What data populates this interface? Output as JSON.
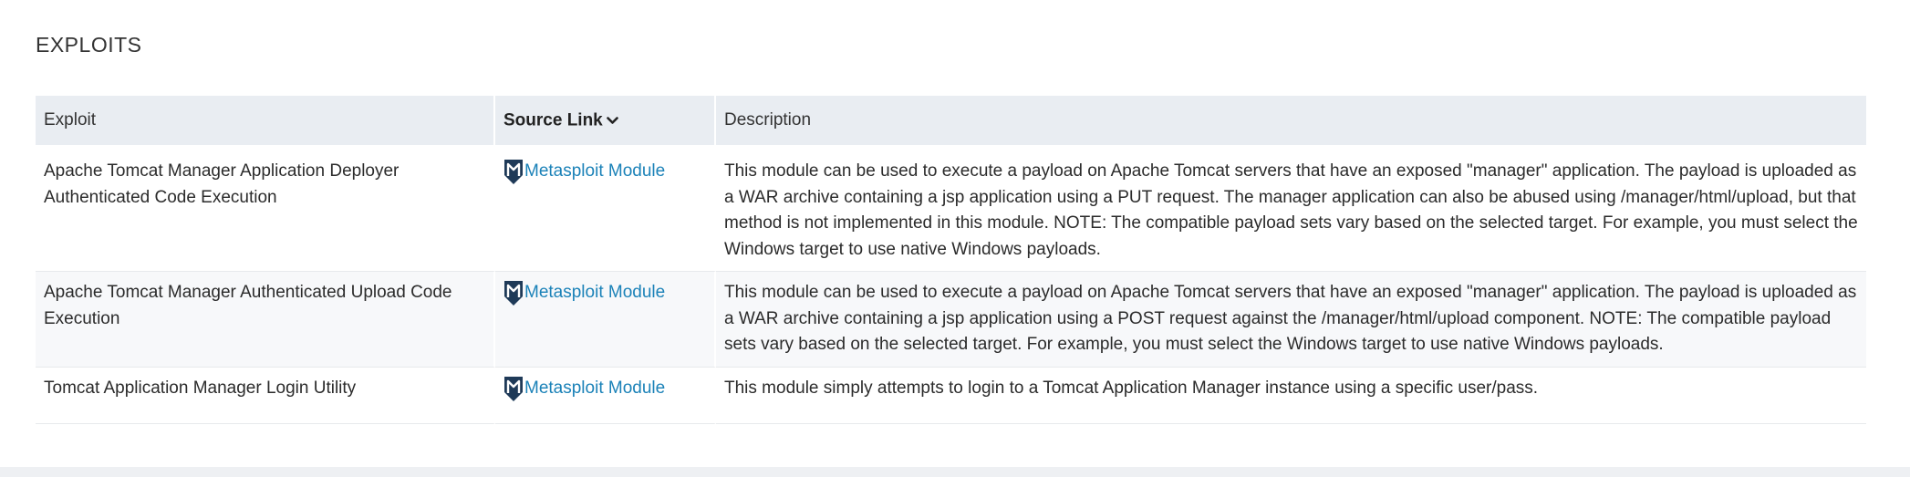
{
  "section": {
    "title": "EXPLOITS"
  },
  "table": {
    "headers": {
      "exploit": "Exploit",
      "source": "Source Link",
      "description": "Description"
    },
    "rows": [
      {
        "exploit": "Apache Tomcat Manager Application Deployer Authenticated Code Execution",
        "source": "Metasploit Module",
        "description": "This module can be used to execute a payload on Apache Tomcat servers that have an exposed \"manager\" application. The payload is uploaded as a WAR archive containing a jsp application using a PUT request. The manager application can also be abused using /manager/html/upload, but that method is not implemented in this module. NOTE: The compatible payload sets vary based on the selected target. For example, you must select the Windows target to use native Windows payloads."
      },
      {
        "exploit": "Apache Tomcat Manager Authenticated Upload Code Execution",
        "source": "Metasploit Module",
        "description": "This module can be used to execute a payload on Apache Tomcat servers that have an exposed \"manager\" application. The payload is uploaded as a WAR archive containing a jsp application using a POST request against the /manager/html/upload component. NOTE: The compatible payload sets vary based on the selected target. For example, you must select the Windows target to use native Windows payloads."
      },
      {
        "exploit": "Tomcat Application Manager Login Utility",
        "source": "Metasploit Module",
        "description": "This module simply attempts to login to a Tomcat Application Manager instance using a specific user/pass."
      }
    ]
  },
  "icons": {
    "sort": "chevron-down-icon",
    "source": "metasploit-icon"
  },
  "colors": {
    "link": "#1b82b8",
    "header_bg": "#e9edf2",
    "stripe_bg": "#f7f8fa",
    "page_bg": "#eef0f3"
  }
}
